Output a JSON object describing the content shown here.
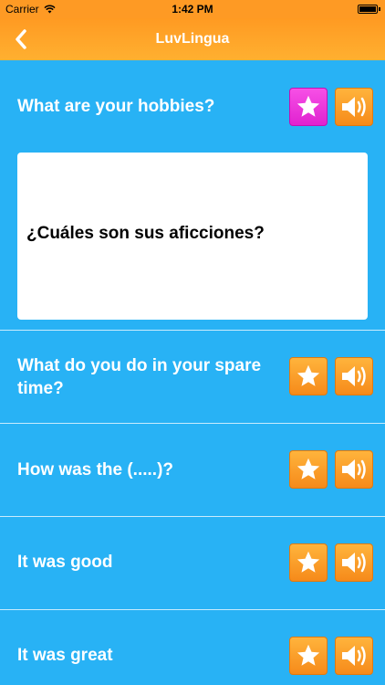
{
  "status_bar": {
    "carrier": "Carrier",
    "time": "1:42 PM"
  },
  "nav": {
    "title": "LuvLingua",
    "back_icon": "chevron-left-icon"
  },
  "phrases": [
    {
      "text": "What are your hobbies?",
      "favorited": true,
      "translation": "¿Cuáles son sus aficciones?"
    },
    {
      "text": "What do you do in your spare time?",
      "favorited": false
    },
    {
      "text": "How was the (.....)?",
      "favorited": false
    },
    {
      "text": "It was good",
      "favorited": false
    },
    {
      "text": "It was great",
      "favorited": false
    }
  ],
  "colors": {
    "background": "#28b2f5",
    "nav_orange": "#fe9a24",
    "favorite_pink": "#e83ad8",
    "button_orange": "#f8991e"
  }
}
